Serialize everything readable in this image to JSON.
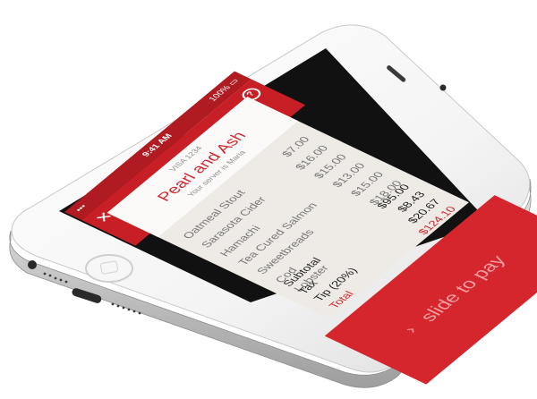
{
  "status_bar": {
    "carrier": "••• ",
    "time": "9:41 AM",
    "battery": "100% ▭"
  },
  "header": {
    "close_icon": "close-icon",
    "info_icon": "info-icon",
    "info_glyph": "?"
  },
  "bill": {
    "payment_method": "VISA 1234",
    "restaurant": "Pearl and Ash",
    "table_line": "Your server is Maria",
    "items": [
      {
        "name": "Oatmeal Stout",
        "price": "$7.00"
      },
      {
        "name": "Sarasota Cider",
        "price": "$16.00"
      },
      {
        "name": "Hamachi",
        "price": "$15.00"
      },
      {
        "name": "Tea Cured Salmon",
        "price": "$13.00"
      },
      {
        "name": "Sweetbreads",
        "price": "$15.00"
      },
      {
        "name": "Cod",
        "price": "$18.00"
      },
      {
        "name": "Lobster",
        "price": ""
      }
    ],
    "totals": {
      "subtotal_label": "Subtotal",
      "subtotal": "$95.00",
      "tax_label": "Tax",
      "tax": "$8.43",
      "tip_label": "Tip (20%)",
      "tip": "$20.67",
      "total_label": "Total",
      "total": "$124.10"
    }
  },
  "slide_to_pay": {
    "chevron": "›",
    "label": "slide to pay"
  },
  "colors": {
    "accent": "#d32630",
    "header": "#c81f26",
    "slidebar": "#d5262e"
  }
}
